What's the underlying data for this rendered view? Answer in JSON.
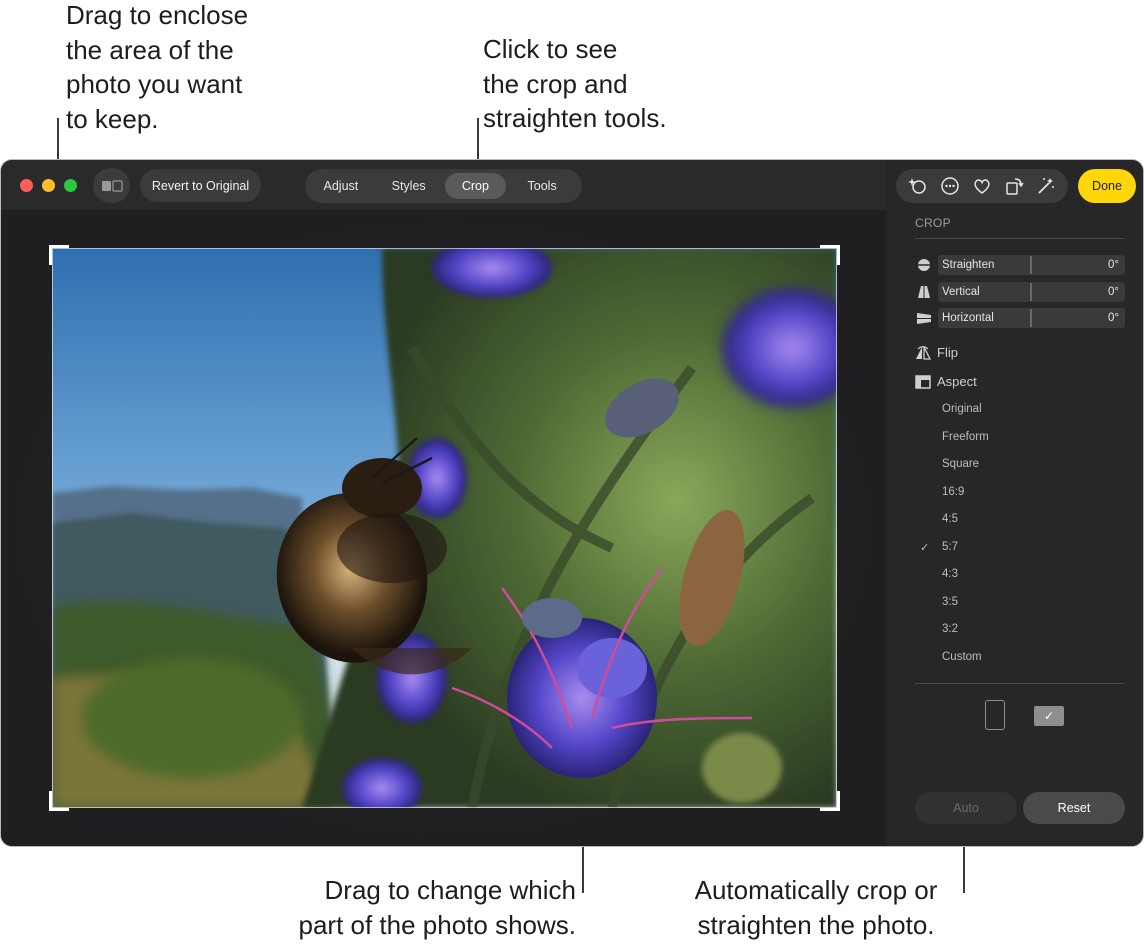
{
  "callouts": {
    "enclose": [
      "Drag to enclose",
      "the area of the",
      "photo you want",
      "to keep."
    ],
    "crop_tools": [
      "Click to see",
      "the crop and",
      "straighten tools."
    ],
    "change_part": [
      "Drag to change which",
      "part of the photo shows."
    ],
    "auto_crop": [
      "Automatically crop or",
      "straighten the photo."
    ]
  },
  "toolbar": {
    "revert_label": "Revert to Original",
    "tabs": [
      {
        "label": "Adjust",
        "active": false
      },
      {
        "label": "Styles",
        "active": false
      },
      {
        "label": "Crop",
        "active": true
      },
      {
        "label": "Tools",
        "active": false
      }
    ],
    "done_label": "Done",
    "tool_icons": [
      "sparkle-add-icon",
      "more-icon",
      "heart-icon",
      "rotate-icon",
      "magic-wand-icon"
    ]
  },
  "sidebar": {
    "heading": "CROP",
    "sliders": [
      {
        "label": "Straighten",
        "value": "0°",
        "icon": "straighten-icon"
      },
      {
        "label": "Vertical",
        "value": "0°",
        "icon": "vertical-perspective-icon"
      },
      {
        "label": "Horizontal",
        "value": "0°",
        "icon": "horizontal-perspective-icon"
      }
    ],
    "flip_label": "Flip",
    "aspect_label": "Aspect",
    "aspect_options": [
      "Original",
      "Freeform",
      "Square",
      "16:9",
      "4:5",
      "5:7",
      "4:3",
      "3:5",
      "3:2",
      "Custom"
    ],
    "aspect_selected": "5:7",
    "check_mark": "✓",
    "auto_label": "Auto",
    "reset_label": "Reset"
  },
  "colors": {
    "accent": "#ffd60a",
    "window": "#1e1e1e",
    "sidebar": "#272729"
  }
}
